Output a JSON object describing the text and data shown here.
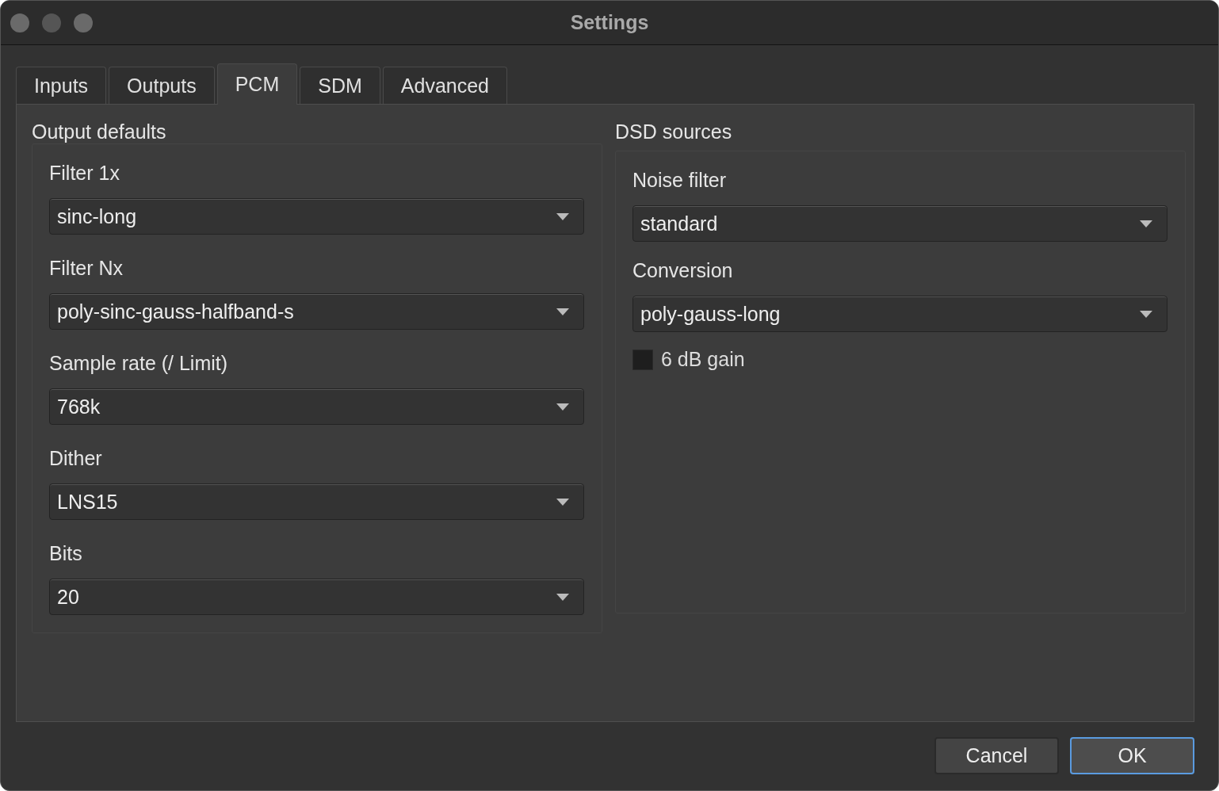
{
  "window": {
    "title": "Settings"
  },
  "tabs": [
    {
      "label": "Inputs",
      "selected": false
    },
    {
      "label": "Outputs",
      "selected": false
    },
    {
      "label": "PCM",
      "selected": true
    },
    {
      "label": "SDM",
      "selected": false
    },
    {
      "label": "Advanced",
      "selected": false
    }
  ],
  "output_defaults": {
    "title": "Output defaults",
    "fields": [
      {
        "label": "Filter 1x",
        "value": "sinc-long"
      },
      {
        "label": "Filter Nx",
        "value": "poly-sinc-gauss-halfband-s"
      },
      {
        "label": "Sample rate (/ Limit)",
        "value": "768k"
      },
      {
        "label": "Dither",
        "value": "LNS15"
      },
      {
        "label": "Bits",
        "value": "20"
      }
    ]
  },
  "dsd_sources": {
    "title": "DSD sources",
    "fields": [
      {
        "label": "Noise filter",
        "value": "standard"
      },
      {
        "label": "Conversion",
        "value": "poly-gauss-long"
      }
    ],
    "checkbox": {
      "label": "6 dB gain",
      "checked": false
    }
  },
  "buttons": [
    {
      "label": "Cancel",
      "default": false
    },
    {
      "label": "OK",
      "default": true
    }
  ]
}
